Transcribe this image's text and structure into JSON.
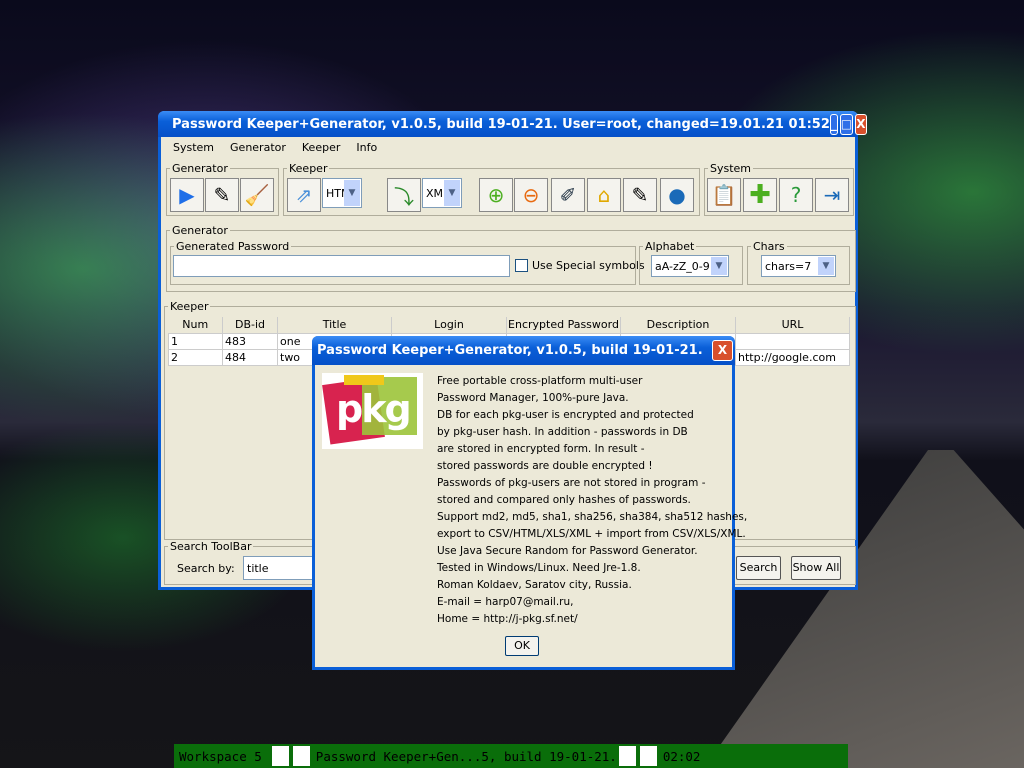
{
  "window": {
    "title": "Password Keeper+Generator, v1.0.5, build 19-01-21. User=root, changed=19.01.21 01:52",
    "minimize": "_",
    "maximize": "□",
    "close": "X"
  },
  "menu": [
    "System",
    "Generator",
    "Keeper",
    "Info"
  ],
  "toolbar": {
    "generator_label": "Generator",
    "keeper_label": "Keeper",
    "system_label": "System",
    "export_format": "HTML",
    "import_format": "XML"
  },
  "generator": {
    "label": "Generated Password",
    "password": "",
    "special_label": "Use Special symbols",
    "alphabet_label": "Alphabet",
    "alphabet": "aA-zZ_0-9",
    "chars_label": "Chars",
    "chars": "chars=7"
  },
  "keeper": {
    "label": "Keeper",
    "columns": [
      "Num",
      "DB-id",
      "Title",
      "Login",
      "Encrypted Password",
      "Description",
      "URL"
    ],
    "rows": [
      [
        "1",
        "483",
        "one",
        "",
        "",
        "",
        ""
      ],
      [
        "2",
        "484",
        "two",
        "",
        "",
        "",
        "http://google.com"
      ]
    ]
  },
  "search": {
    "label": "Search ToolBar",
    "by_label": "Search by:",
    "field": "title",
    "search": "Search",
    "show_all": "Show All"
  },
  "dialog": {
    "title": "Password Keeper+Generator, v1.0.5, build 19-01-21.",
    "logo_text": "pkg",
    "ok": "OK",
    "lines": [
      "Free portable cross-platform multi-user",
      "Password Manager, 100%-pure Java.",
      "DB for each pkg-user is encrypted and protected",
      "by pkg-user hash. In addition - passwords in DB",
      "are stored in encrypted form. In result -",
      "stored passwords are double encrypted !",
      "Passwords of pkg-users are not stored in program -",
      "stored and compared only hashes of passwords.",
      "Support md2, md5, sha1, sha256, sha384, sha512 hashes,",
      "export to CSV/HTML/XLS/XML + import from CSV/XLS/XML.",
      "Use Java Secure Random for Password Generator.",
      "Tested in Windows/Linux. Need Jre-1.8.",
      "Roman Koldaev, Saratov city, Russia.",
      "E-mail = harp07@mail.ru,",
      "Home = http://j-pkg.sf.net/"
    ]
  },
  "taskbar": {
    "workspace": "Workspace 5",
    "task": "Password Keeper+Gen...5, build 19-01-21.",
    "clock": "02:02"
  }
}
